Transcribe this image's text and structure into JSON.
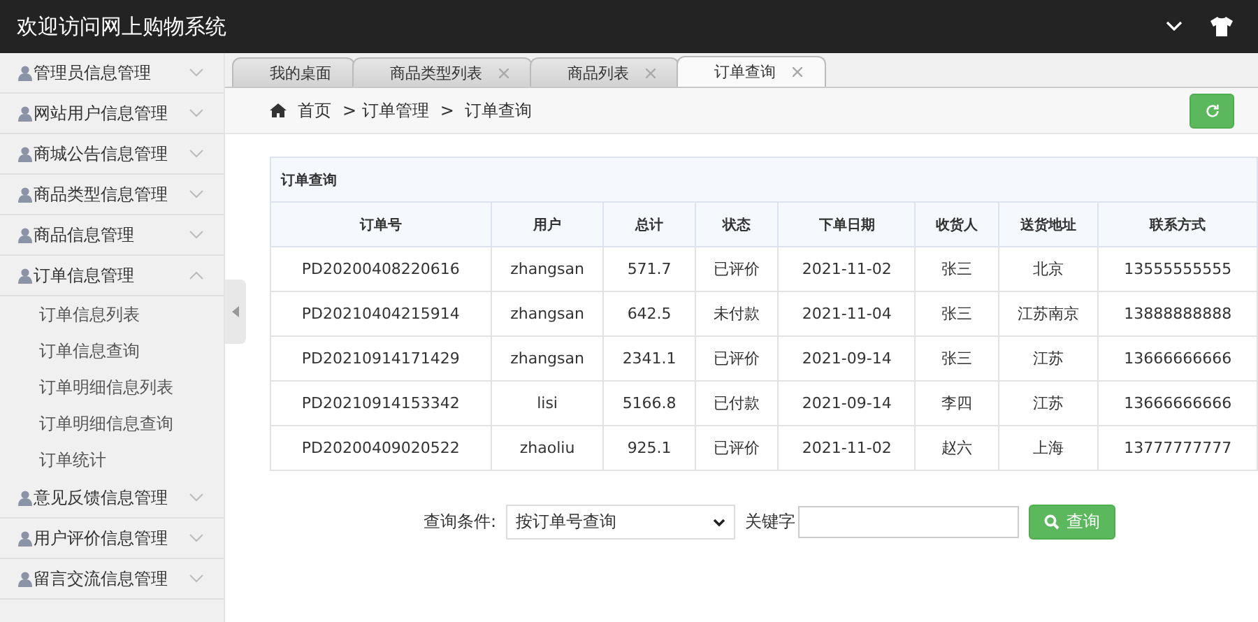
{
  "header": {
    "title": "欢迎访问网上购物系统"
  },
  "sidebar": {
    "items": [
      {
        "label": "管理员信息管理",
        "expanded": false
      },
      {
        "label": "网站用户信息管理",
        "expanded": false
      },
      {
        "label": "商城公告信息管理",
        "expanded": false
      },
      {
        "label": "商品类型信息管理",
        "expanded": false
      },
      {
        "label": "商品信息管理",
        "expanded": false
      },
      {
        "label": "订单信息管理",
        "expanded": true,
        "children": [
          {
            "label": "订单信息列表"
          },
          {
            "label": "订单信息查询"
          },
          {
            "label": "订单明细信息列表"
          },
          {
            "label": "订单明细信息查询"
          },
          {
            "label": "订单统计"
          }
        ]
      },
      {
        "label": "意见反馈信息管理",
        "expanded": false
      },
      {
        "label": "用户评价信息管理",
        "expanded": false
      },
      {
        "label": "留言交流信息管理",
        "expanded": false
      }
    ]
  },
  "tabs": [
    {
      "label": "我的桌面",
      "selected": false,
      "closable": false
    },
    {
      "label": "商品类型列表",
      "selected": false,
      "closable": true
    },
    {
      "label": "商品列表",
      "selected": false,
      "closable": true
    },
    {
      "label": "订单查询",
      "selected": true,
      "closable": true
    }
  ],
  "breadcrumb": [
    "首页",
    "> 订单管理",
    ">  订单查询"
  ],
  "table": {
    "title": "订单查询",
    "columns": [
      "订单号",
      "用户",
      "总计",
      "状态",
      "下单日期",
      "收货人",
      "送货地址",
      "联系方式"
    ],
    "rows": [
      [
        "PD20200408220616",
        "zhangsan",
        "571.7",
        "已评价",
        "2021-11-02",
        "张三",
        "北京",
        "13555555555"
      ],
      [
        "PD20210404215914",
        "zhangsan",
        "642.5",
        "未付款",
        "2021-11-04",
        "张三",
        "江苏南京",
        "13888888888"
      ],
      [
        "PD20210914171429",
        "zhangsan",
        "2341.1",
        "已评价",
        "2021-09-14",
        "张三",
        "江苏",
        "13666666666"
      ],
      [
        "PD20210914153342",
        "lisi",
        "5166.8",
        "已付款",
        "2021-09-14",
        "李四",
        "江苏",
        "13666666666"
      ],
      [
        "PD20200409020522",
        "zhaoliu",
        "925.1",
        "已评价",
        "2021-11-02",
        "赵六",
        "上海",
        "13777777777"
      ]
    ]
  },
  "search": {
    "condition_label": "查询条件:",
    "condition_value": "按订单号查询",
    "keyword_label": "关键字",
    "button": "查询"
  }
}
